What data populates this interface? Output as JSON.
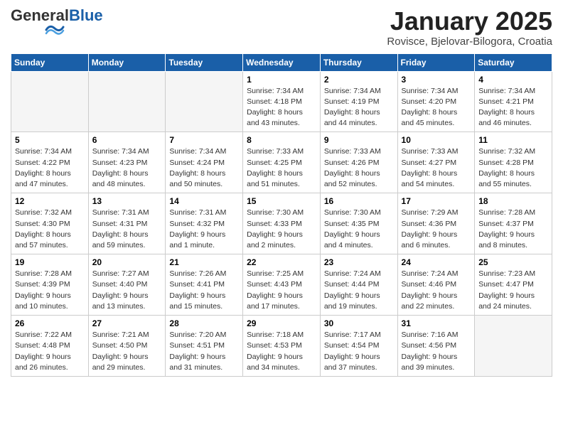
{
  "header": {
    "logo_general": "General",
    "logo_blue": "Blue",
    "month_title": "January 2025",
    "location": "Rovisce, Bjelovar-Bilogora, Croatia"
  },
  "weekdays": [
    "Sunday",
    "Monday",
    "Tuesday",
    "Wednesday",
    "Thursday",
    "Friday",
    "Saturday"
  ],
  "weeks": [
    [
      {
        "day": "",
        "info": ""
      },
      {
        "day": "",
        "info": ""
      },
      {
        "day": "",
        "info": ""
      },
      {
        "day": "1",
        "info": "Sunrise: 7:34 AM\nSunset: 4:18 PM\nDaylight: 8 hours\nand 43 minutes."
      },
      {
        "day": "2",
        "info": "Sunrise: 7:34 AM\nSunset: 4:19 PM\nDaylight: 8 hours\nand 44 minutes."
      },
      {
        "day": "3",
        "info": "Sunrise: 7:34 AM\nSunset: 4:20 PM\nDaylight: 8 hours\nand 45 minutes."
      },
      {
        "day": "4",
        "info": "Sunrise: 7:34 AM\nSunset: 4:21 PM\nDaylight: 8 hours\nand 46 minutes."
      }
    ],
    [
      {
        "day": "5",
        "info": "Sunrise: 7:34 AM\nSunset: 4:22 PM\nDaylight: 8 hours\nand 47 minutes."
      },
      {
        "day": "6",
        "info": "Sunrise: 7:34 AM\nSunset: 4:23 PM\nDaylight: 8 hours\nand 48 minutes."
      },
      {
        "day": "7",
        "info": "Sunrise: 7:34 AM\nSunset: 4:24 PM\nDaylight: 8 hours\nand 50 minutes."
      },
      {
        "day": "8",
        "info": "Sunrise: 7:33 AM\nSunset: 4:25 PM\nDaylight: 8 hours\nand 51 minutes."
      },
      {
        "day": "9",
        "info": "Sunrise: 7:33 AM\nSunset: 4:26 PM\nDaylight: 8 hours\nand 52 minutes."
      },
      {
        "day": "10",
        "info": "Sunrise: 7:33 AM\nSunset: 4:27 PM\nDaylight: 8 hours\nand 54 minutes."
      },
      {
        "day": "11",
        "info": "Sunrise: 7:32 AM\nSunset: 4:28 PM\nDaylight: 8 hours\nand 55 minutes."
      }
    ],
    [
      {
        "day": "12",
        "info": "Sunrise: 7:32 AM\nSunset: 4:30 PM\nDaylight: 8 hours\nand 57 minutes."
      },
      {
        "day": "13",
        "info": "Sunrise: 7:31 AM\nSunset: 4:31 PM\nDaylight: 8 hours\nand 59 minutes."
      },
      {
        "day": "14",
        "info": "Sunrise: 7:31 AM\nSunset: 4:32 PM\nDaylight: 9 hours\nand 1 minute."
      },
      {
        "day": "15",
        "info": "Sunrise: 7:30 AM\nSunset: 4:33 PM\nDaylight: 9 hours\nand 2 minutes."
      },
      {
        "day": "16",
        "info": "Sunrise: 7:30 AM\nSunset: 4:35 PM\nDaylight: 9 hours\nand 4 minutes."
      },
      {
        "day": "17",
        "info": "Sunrise: 7:29 AM\nSunset: 4:36 PM\nDaylight: 9 hours\nand 6 minutes."
      },
      {
        "day": "18",
        "info": "Sunrise: 7:28 AM\nSunset: 4:37 PM\nDaylight: 9 hours\nand 8 minutes."
      }
    ],
    [
      {
        "day": "19",
        "info": "Sunrise: 7:28 AM\nSunset: 4:39 PM\nDaylight: 9 hours\nand 10 minutes."
      },
      {
        "day": "20",
        "info": "Sunrise: 7:27 AM\nSunset: 4:40 PM\nDaylight: 9 hours\nand 13 minutes."
      },
      {
        "day": "21",
        "info": "Sunrise: 7:26 AM\nSunset: 4:41 PM\nDaylight: 9 hours\nand 15 minutes."
      },
      {
        "day": "22",
        "info": "Sunrise: 7:25 AM\nSunset: 4:43 PM\nDaylight: 9 hours\nand 17 minutes."
      },
      {
        "day": "23",
        "info": "Sunrise: 7:24 AM\nSunset: 4:44 PM\nDaylight: 9 hours\nand 19 minutes."
      },
      {
        "day": "24",
        "info": "Sunrise: 7:24 AM\nSunset: 4:46 PM\nDaylight: 9 hours\nand 22 minutes."
      },
      {
        "day": "25",
        "info": "Sunrise: 7:23 AM\nSunset: 4:47 PM\nDaylight: 9 hours\nand 24 minutes."
      }
    ],
    [
      {
        "day": "26",
        "info": "Sunrise: 7:22 AM\nSunset: 4:48 PM\nDaylight: 9 hours\nand 26 minutes."
      },
      {
        "day": "27",
        "info": "Sunrise: 7:21 AM\nSunset: 4:50 PM\nDaylight: 9 hours\nand 29 minutes."
      },
      {
        "day": "28",
        "info": "Sunrise: 7:20 AM\nSunset: 4:51 PM\nDaylight: 9 hours\nand 31 minutes."
      },
      {
        "day": "29",
        "info": "Sunrise: 7:18 AM\nSunset: 4:53 PM\nDaylight: 9 hours\nand 34 minutes."
      },
      {
        "day": "30",
        "info": "Sunrise: 7:17 AM\nSunset: 4:54 PM\nDaylight: 9 hours\nand 37 minutes."
      },
      {
        "day": "31",
        "info": "Sunrise: 7:16 AM\nSunset: 4:56 PM\nDaylight: 9 hours\nand 39 minutes."
      },
      {
        "day": "",
        "info": ""
      }
    ]
  ]
}
